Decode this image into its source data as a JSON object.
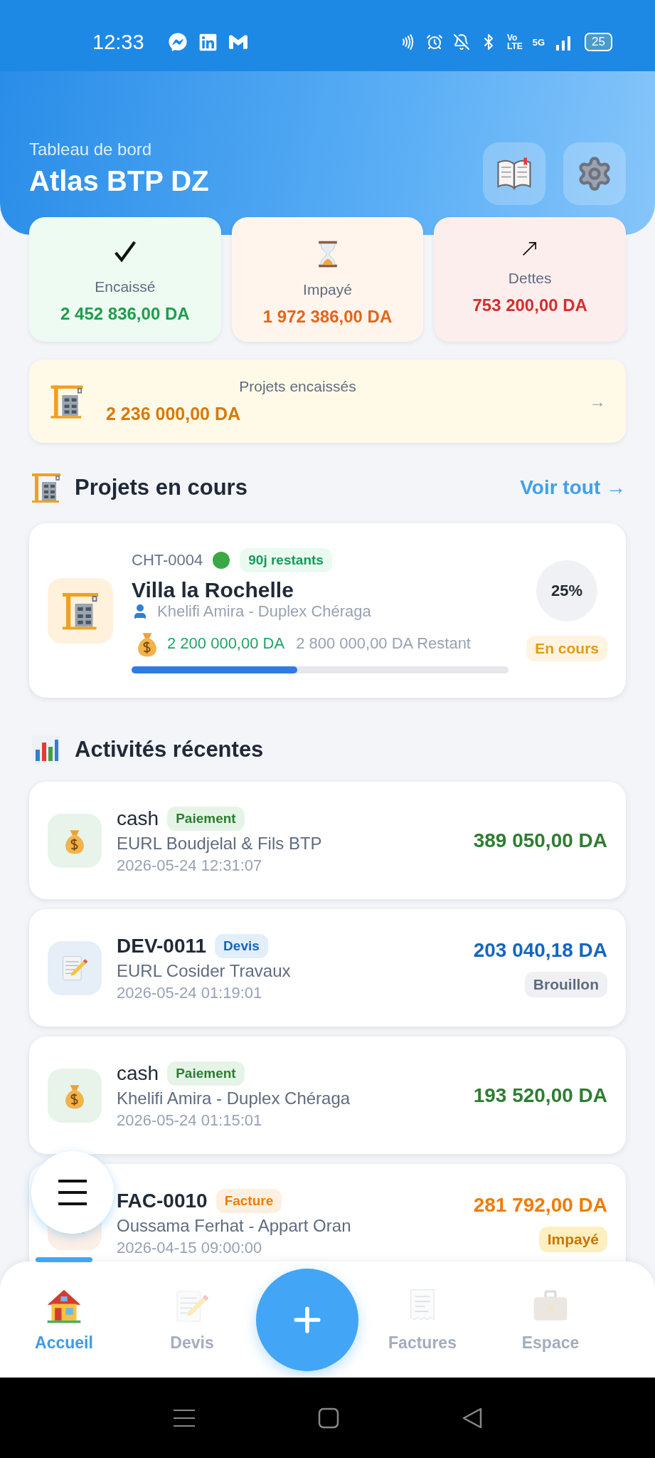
{
  "status_bar": {
    "time": "12:33",
    "volte_top": "Vo",
    "volte_bottom": "LTE",
    "network": "5G",
    "battery": "25"
  },
  "header": {
    "subtitle": "Tableau de bord",
    "title": "Atlas BTP DZ"
  },
  "stats": [
    {
      "kind": "collected",
      "label": "Encaissé",
      "value": "2 452 836,00 DA"
    },
    {
      "kind": "unpaid",
      "label": "Impayé",
      "value": "1 972 386,00 DA"
    },
    {
      "kind": "debts",
      "label": "Dettes",
      "value": "753 200,00 DA"
    }
  ],
  "projects_collected": {
    "label": "Projets encaissés",
    "value": "2 236 000,00 DA",
    "arrow": "→"
  },
  "projects_section": {
    "title": "Projets en cours",
    "link": "Voir tout →"
  },
  "project": {
    "code": "CHT-0004",
    "days_left": "90j restants",
    "name": "Villa la Rochelle",
    "client": "Khelifi Amira - Duplex Chéraga",
    "paid": "2 200 000,00 DA",
    "remaining": "2 800 000,00 DA Restant",
    "level": 0.44,
    "percent": "25%",
    "status": "En cours"
  },
  "activities_section": {
    "title": "Activités récentes"
  },
  "activities": [
    {
      "kind": "payment",
      "title": "cash",
      "tag": "Paiement",
      "subtitle": "EURL Boudjelal & Fils BTP",
      "date": "2026-05-24 12:31:07",
      "amount": "389 050,00 DA"
    },
    {
      "kind": "quote",
      "title": "DEV-0011",
      "tag": "Devis",
      "subtitle": "EURL Cosider Travaux",
      "date": "2026-05-24 01:19:01",
      "amount": "203 040,18 DA",
      "status": {
        "kind": "draft",
        "label": "Brouillon"
      }
    },
    {
      "kind": "payment",
      "title": "cash",
      "tag": "Paiement",
      "subtitle": "Khelifi Amira - Duplex Chéraga",
      "date": "2026-05-24 01:15:01",
      "amount": "193 520,00 DA"
    },
    {
      "kind": "invoice",
      "title": "FAC-0010",
      "tag": "Facture",
      "subtitle": "Oussama Ferhat - Appart Oran",
      "date": "2026-04-15 09:00:00",
      "amount": "281 792,00 DA",
      "status": {
        "kind": "unpaid",
        "label": "Impayé"
      }
    }
  ],
  "bottom_nav": [
    {
      "kind": "home",
      "label": "Accueil",
      "selected": true
    },
    {
      "kind": "quotes",
      "label": "Devis",
      "selected": false
    },
    {
      "kind": "invoices",
      "label": "Factures",
      "selected": false
    },
    {
      "kind": "space",
      "label": "Espace",
      "selected": false
    }
  ]
}
